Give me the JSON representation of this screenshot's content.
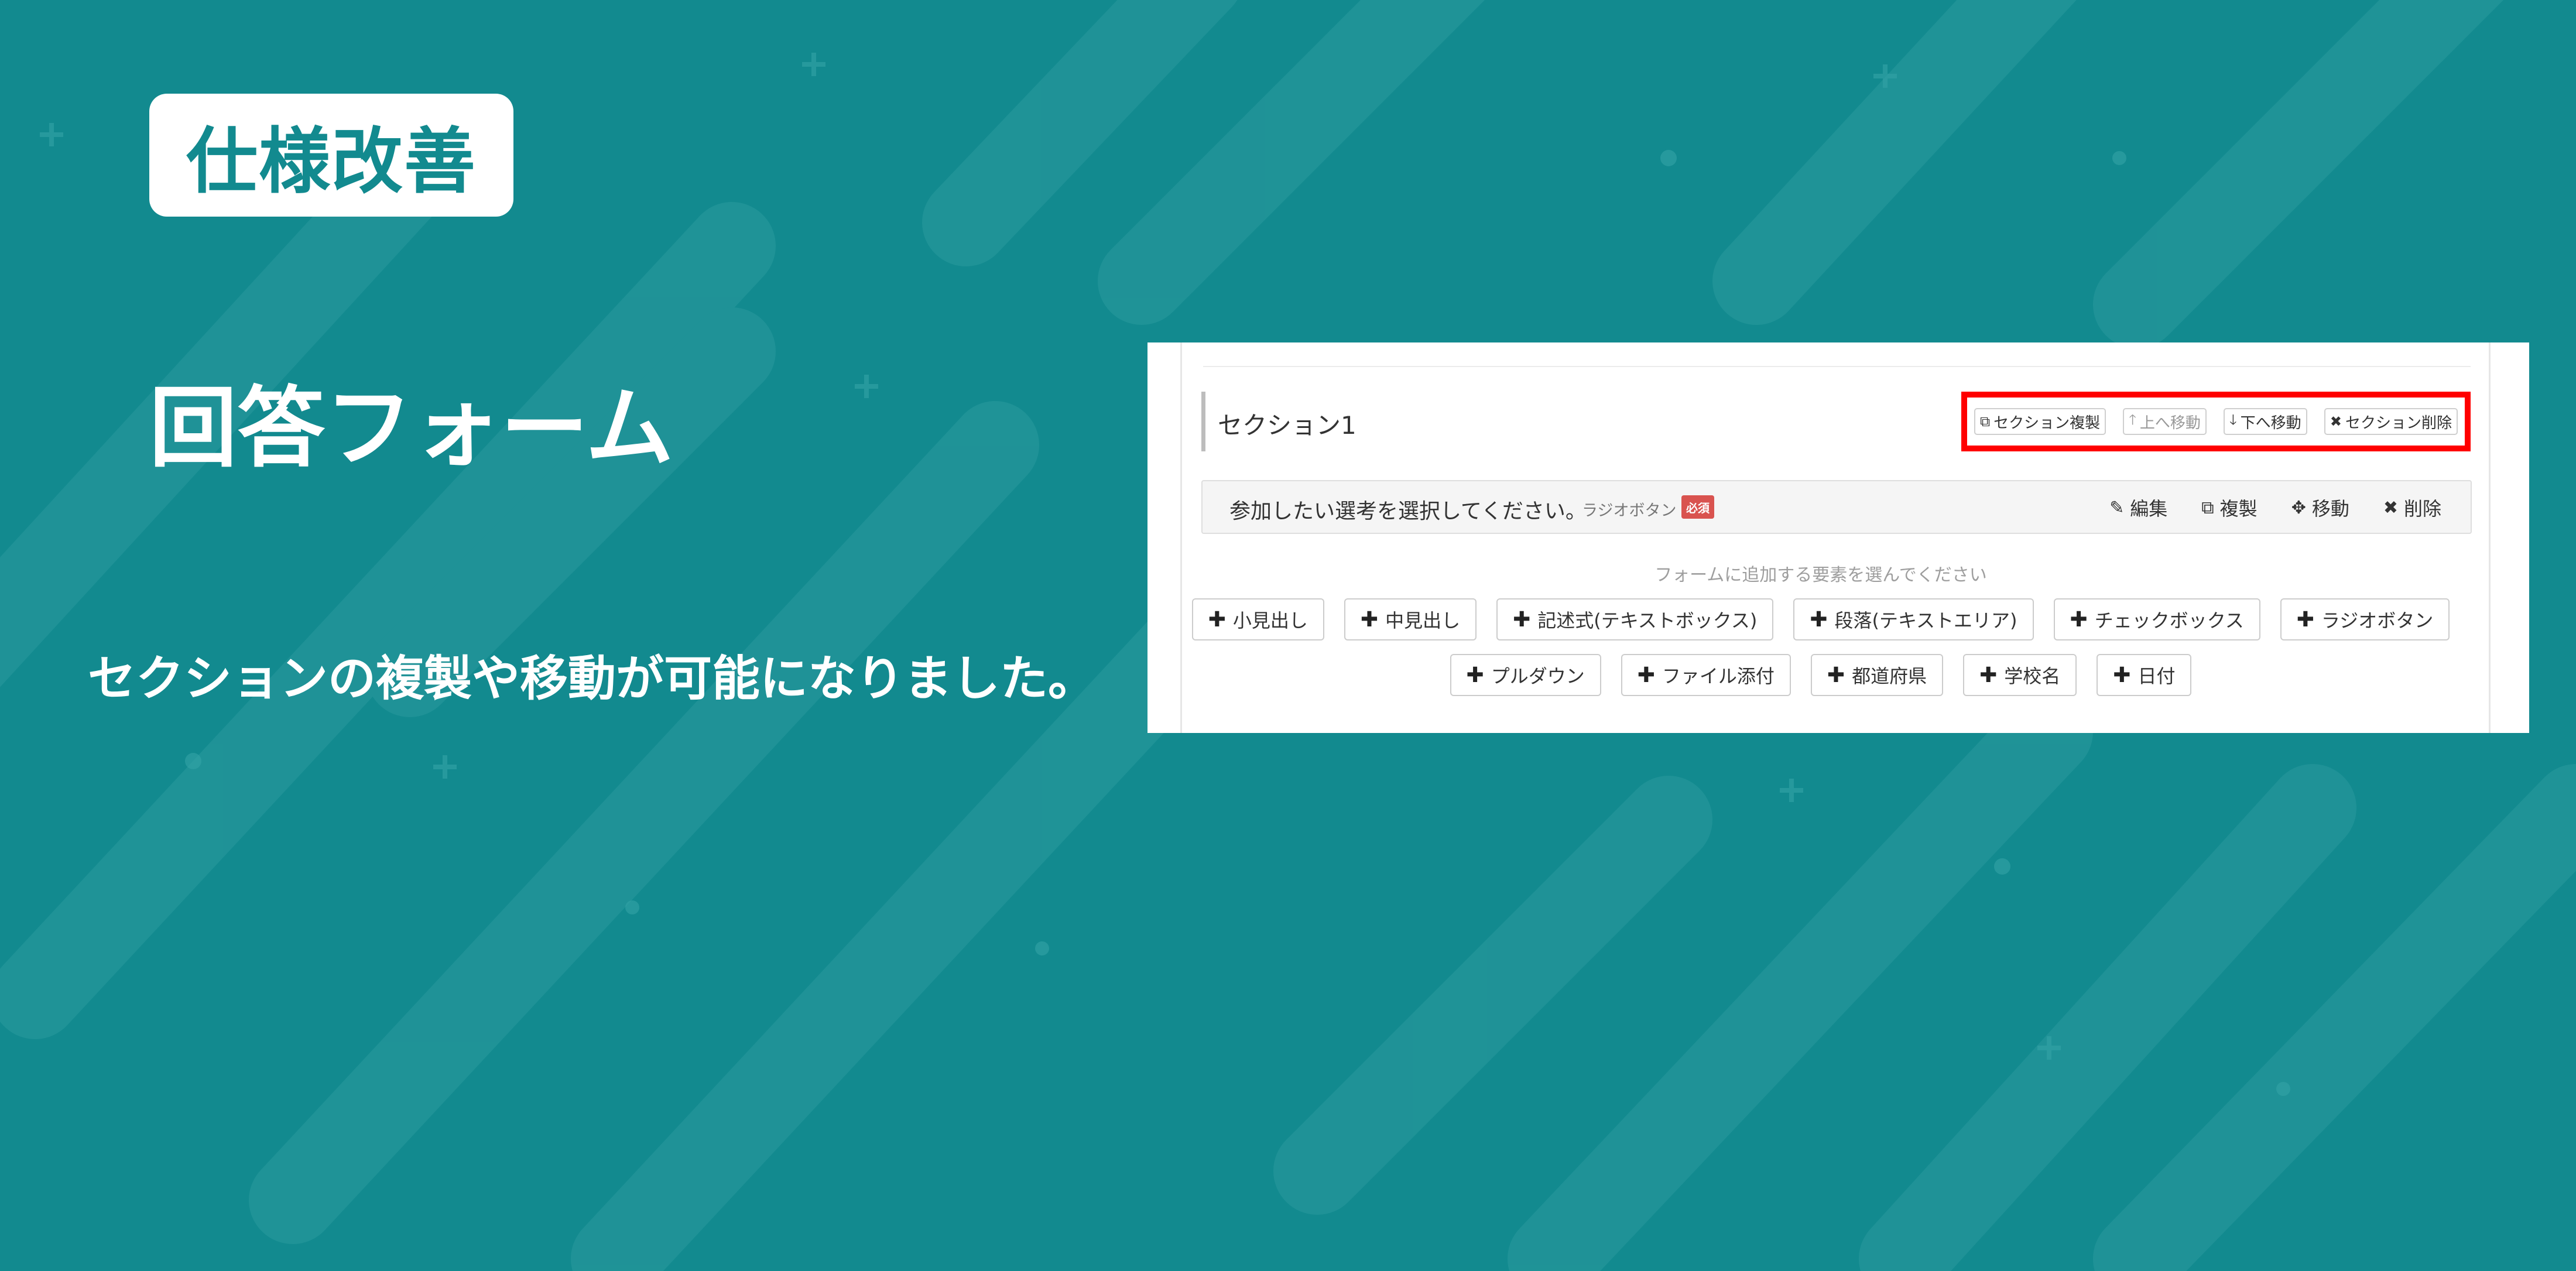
{
  "slide": {
    "tag": "仕様改善",
    "title": "回答フォーム",
    "description": "セクションの複製や移動が可能になりました。"
  },
  "colors": {
    "background": "#128a8f",
    "highlight": "#ff0000",
    "required_badge": "#d9534f"
  },
  "form": {
    "section_title": "セクション1",
    "section_actions": [
      {
        "label": "セクション複製",
        "icon": "copy-icon",
        "enabled": true
      },
      {
        "label": "上へ移動",
        "icon": "arrow-up-icon",
        "enabled": false
      },
      {
        "label": "下へ移動",
        "icon": "arrow-down-icon",
        "enabled": true
      },
      {
        "label": "セクション削除",
        "icon": "close-icon",
        "enabled": true
      }
    ],
    "question": {
      "text": "参加したい選考を選択してください。",
      "type": "ラジオボタン",
      "required_badge": "必須",
      "actions": [
        {
          "label": "編集",
          "icon": "pencil-icon"
        },
        {
          "label": "複製",
          "icon": "copy-icon"
        },
        {
          "label": "移動",
          "icon": "move-icon"
        },
        {
          "label": "削除",
          "icon": "close-icon"
        }
      ]
    },
    "add_hint": "フォームに追加する要素を選んでください",
    "add_buttons_row1": [
      "小見出し",
      "中見出し",
      "記述式(テキストボックス)",
      "段落(テキストエリア)",
      "チェックボックス",
      "ラジオボタン"
    ],
    "add_buttons_row2": [
      "プルダウン",
      "ファイル添付",
      "都道府県",
      "学校名",
      "日付"
    ]
  }
}
